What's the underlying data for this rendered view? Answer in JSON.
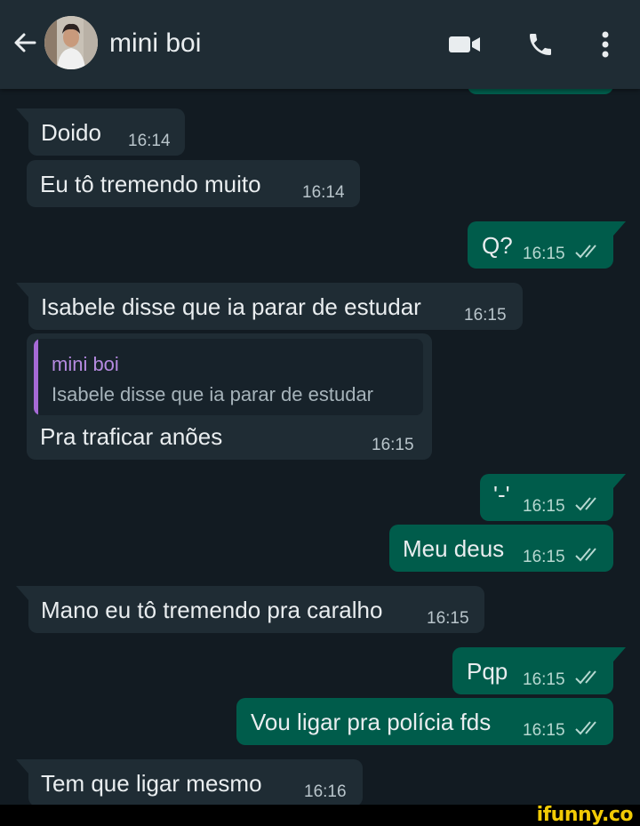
{
  "header": {
    "contact_name": "mini boi",
    "icons": [
      "back-arrow-icon",
      "video-call-icon",
      "voice-call-icon",
      "more-options-icon"
    ]
  },
  "messages": [
    {
      "direction": "in",
      "text": "Doido",
      "time": "16:14"
    },
    {
      "direction": "in",
      "text": "Eu tô tremendo muito",
      "time": "16:14"
    },
    {
      "direction": "out",
      "text": "Q?",
      "time": "16:15",
      "status": "read"
    },
    {
      "direction": "in",
      "text": "Isabele disse que ia parar de estudar",
      "time": "16:15"
    },
    {
      "direction": "in",
      "text": "Pra traficar anões",
      "time": "16:15",
      "reply_to": {
        "author": "mini boi",
        "text": "Isabele disse que ia parar de estudar"
      }
    },
    {
      "direction": "out",
      "text": "'-'",
      "time": "16:15",
      "status": "read"
    },
    {
      "direction": "out",
      "text": "Meu deus",
      "time": "16:15",
      "status": "read"
    },
    {
      "direction": "in",
      "text": "Mano eu tô tremendo pra caralho",
      "time": "16:15"
    },
    {
      "direction": "out",
      "text": "Pqp",
      "time": "16:15",
      "status": "read"
    },
    {
      "direction": "out",
      "text": "Vou ligar pra polícia fds",
      "time": "16:15",
      "status": "read"
    },
    {
      "direction": "in",
      "text": "Tem que ligar mesmo",
      "time": "16:16"
    }
  ],
  "watermark": "ifunny.co",
  "colors": {
    "background": "#121b22",
    "header": "#1f2c34",
    "incoming_bubble": "#1f2c34",
    "outgoing_bubble": "#005c4b",
    "read_ticks": "#b7d8d1",
    "quote_accent": "#a66ad6"
  }
}
